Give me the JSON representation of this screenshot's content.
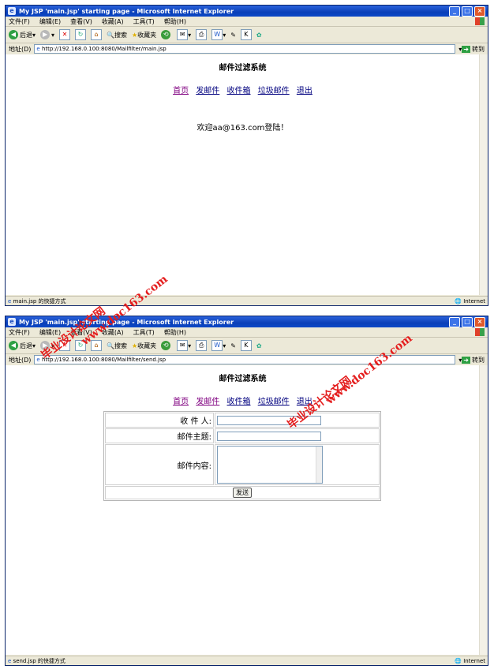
{
  "menu": [
    "文件(F)",
    "编辑(E)",
    "查看(V)",
    "收藏(A)",
    "工具(T)",
    "帮助(H)"
  ],
  "toolbar": {
    "back": "后退",
    "search": "搜索",
    "favorites": "收藏夹"
  },
  "address": {
    "label": "地址(D)",
    "go": "转到"
  },
  "status_zone": "Internet",
  "nav": [
    "首页",
    "发邮件",
    "收件箱",
    "垃圾邮件",
    "退出"
  ],
  "system_title": "邮件过滤系统",
  "win1": {
    "title": "My JSP 'main.jsp' starting page - Microsoft Internet Explorer",
    "url": "http://192.168.0.100:8080/Mailfilter/main.jsp",
    "welcome": "欢迎aa@163.com登陆！",
    "status": "main.jsp  的快捷方式"
  },
  "win2": {
    "title": "My JSP 'main.jsp' starting page - Microsoft Internet Explorer",
    "url": "http://192.168.0.100:8080/Mailfilter/send.jsp",
    "status": "send.jsp  的快捷方式",
    "form": {
      "recipient_label": "收  件  人:",
      "subject_label": "邮件主题:",
      "content_label": "邮件内容:",
      "send_button": "发送"
    }
  },
  "watermark": {
    "cn": "毕业设计论文网",
    "url": "www.doc163.com"
  }
}
